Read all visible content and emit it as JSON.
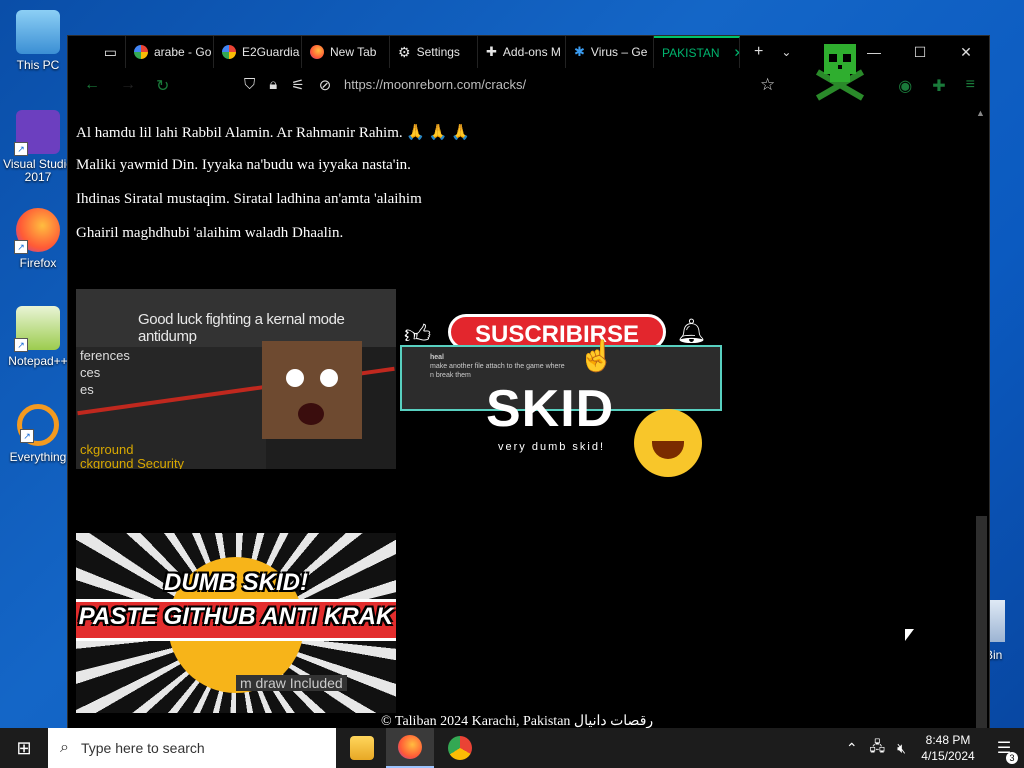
{
  "desktop": {
    "icons": [
      {
        "label": "This PC"
      },
      {
        "label": "Visual Studio 2017"
      },
      {
        "label": "Firefox"
      },
      {
        "label": "Notepad++"
      },
      {
        "label": "Everything"
      }
    ],
    "recycle_partial": "Bin"
  },
  "browser": {
    "tabs": [
      {
        "title": "arabe - Go"
      },
      {
        "title": "E2Guardia"
      },
      {
        "title": "New Tab"
      },
      {
        "title": "Settings"
      },
      {
        "title": "Add-ons M"
      },
      {
        "title": "Virus – Ge"
      },
      {
        "title": "PAKISTAN"
      }
    ],
    "url": "https://moonreborn.com/cracks/"
  },
  "page": {
    "prayer_lines": [
      "Al hamdu lil lahi Rabbil Alamin. Ar Rahmanir Rahim. 🙏 🙏 🙏",
      "Maliki yawmid Din. Iyyaka na'budu wa iyyaka nasta'in.",
      "Ihdinas Siratal mustaqim. Siratal ladhina an'amta 'alaihim",
      "Ghairil maghdhubi 'alaihim waladh Dhaalin."
    ],
    "image1": {
      "header_text": "Good luck fighting a kernal mode antidump",
      "list_items": [
        "ferences",
        "ces",
        "es"
      ],
      "bottom_text": "ckground\nckground Security"
    },
    "image2": {
      "button_text": "SUSCRIBIRSE",
      "chat_user": "heal",
      "chat_line1": "make another file attach to the game where",
      "chat_line2": "n break them",
      "title": "SKID",
      "caption": "very dumb skid!"
    },
    "image3": {
      "line1": "DUMB SKID!",
      "line2": "PASTE GITHUB ANTI KRAK",
      "hint": "m draw Included"
    },
    "footer": "© Taliban 2024 Karachi, Pakistan رقصات دانيال"
  },
  "taskbar": {
    "search_placeholder": "Type here to search",
    "time": "8:48 PM",
    "date": "4/15/2024",
    "notification_count": "3"
  }
}
